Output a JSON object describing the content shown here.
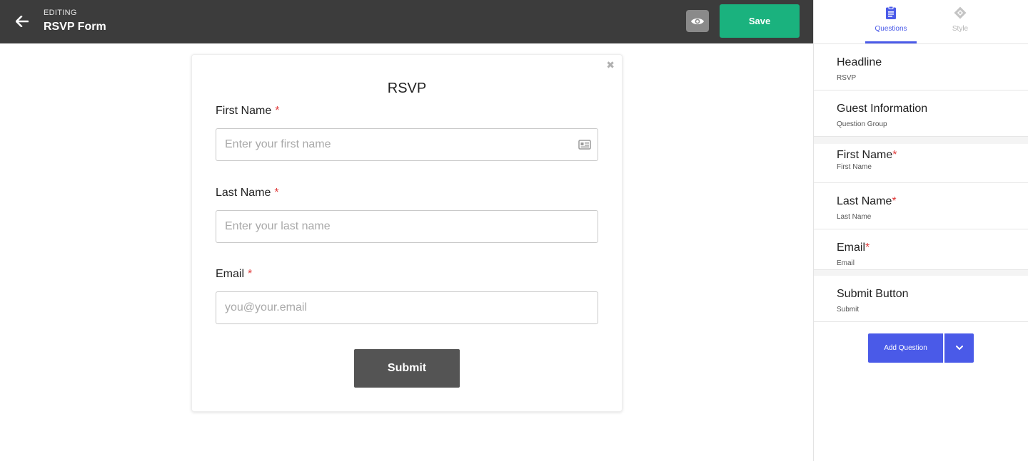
{
  "header": {
    "editing_label": "EDITING",
    "form_title": "RSVP Form",
    "save_label": "Save"
  },
  "form": {
    "headline": "RSVP",
    "fields": [
      {
        "label": "First Name",
        "required_mark": "*",
        "placeholder": "Enter your first name"
      },
      {
        "label": "Last Name",
        "required_mark": "*",
        "placeholder": "Enter your last name"
      },
      {
        "label": "Email",
        "required_mark": "*",
        "placeholder": "you@your.email"
      }
    ],
    "submit_label": "Submit",
    "close_glyph": "✖"
  },
  "sidebar": {
    "tabs": [
      {
        "label": "Questions",
        "icon": "clipboard-icon"
      },
      {
        "label": "Style",
        "icon": "paint-icon"
      }
    ],
    "items": [
      {
        "title": "Headline",
        "subtitle": "RSVP",
        "required_mark": ""
      },
      {
        "title": "Guest Information",
        "subtitle": "Question Group",
        "required_mark": ""
      },
      {
        "title": "First Name",
        "subtitle": "First Name",
        "required_mark": "*"
      },
      {
        "title": "Last Name",
        "subtitle": "Last Name",
        "required_mark": "*"
      },
      {
        "title": "Email",
        "subtitle": "Email",
        "required_mark": "*"
      },
      {
        "title": "Submit Button",
        "subtitle": "Submit",
        "required_mark": ""
      }
    ],
    "add_question_label": "Add Question"
  },
  "colors": {
    "topbar": "#3c3c3c",
    "save": "#1ab27e",
    "accent": "#4a5ae8",
    "required": "#e03b3b",
    "submit": "#545454"
  }
}
